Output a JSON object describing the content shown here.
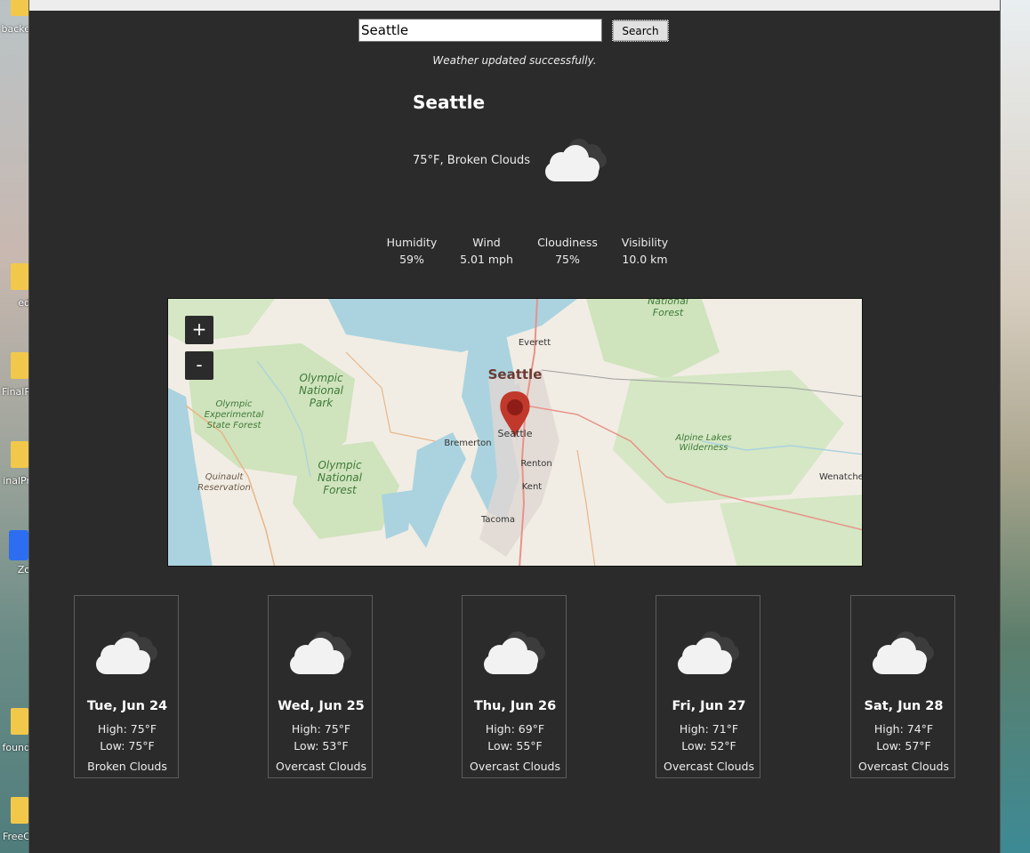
{
  "window": {
    "title_bar_visible": true
  },
  "desktop": {
    "icons": [
      {
        "label": "backe",
        "kind": "folder"
      },
      {
        "label": "ed",
        "kind": "folder"
      },
      {
        "label": "FinalP",
        "kind": "folder"
      },
      {
        "label": "inalPr",
        "kind": "folder"
      },
      {
        "label": "Zo",
        "kind": "zoom"
      },
      {
        "label": "found",
        "kind": "folder"
      },
      {
        "label": "FreeC",
        "kind": "folder"
      }
    ]
  },
  "search": {
    "value": "Seattle",
    "button_label": "Search"
  },
  "status_message": "Weather updated successfully.",
  "city": "Seattle",
  "current": {
    "summary": "75°F, Broken Clouds",
    "icon": "broken-clouds-icon"
  },
  "metrics": [
    {
      "label": "Humidity",
      "value": "59%"
    },
    {
      "label": "Wind",
      "value": "5.01 mph"
    },
    {
      "label": "Cloudiness",
      "value": "75%"
    },
    {
      "label": "Visibility",
      "value": "10.0 km"
    }
  ],
  "map": {
    "zoom_in": "+",
    "zoom_out": "-",
    "marker_label": "Seattle",
    "labels": {
      "national_forest_top": "National",
      "forest_top": "Forest",
      "everett": "Everett",
      "seattle_big": "Seattle",
      "olympic": "Olympic",
      "national": "National",
      "park": "Park",
      "olympic_exp": "Olympic",
      "experimental": "Experimental",
      "state_forest": "State Forest",
      "bremerton": "Bremerton",
      "renton": "Renton",
      "kent": "Kent",
      "tacoma": "Tacoma",
      "quinault": "Quinault",
      "reservation": "Reservation",
      "olympic_nf": "Olympic",
      "national_nf": "National",
      "forest_nf": "Forest",
      "alpine": "Alpine Lakes",
      "wilderness": "Wilderness",
      "wenatchee": "Wenatchee"
    }
  },
  "forecast": [
    {
      "date": "Tue, Jun 24",
      "high": "High: 75°F",
      "low": "Low: 75°F",
      "description": "Broken Clouds"
    },
    {
      "date": "Wed, Jun 25",
      "high": "High: 75°F",
      "low": "Low: 53°F",
      "description": "Overcast Clouds"
    },
    {
      "date": "Thu, Jun 26",
      "high": "High: 69°F",
      "low": "Low: 55°F",
      "description": "Overcast Clouds"
    },
    {
      "date": "Fri, Jun 27",
      "high": "High: 71°F",
      "low": "Low: 52°F",
      "description": "Overcast Clouds"
    },
    {
      "date": "Sat, Jun 28",
      "high": "High: 74°F",
      "low": "Low: 57°F",
      "description": "Overcast Clouds"
    }
  ],
  "colors": {
    "window_bg": "#2b2b2b",
    "marker": "#c0392b",
    "water": "#aad3df",
    "park": "#c8e0b0"
  }
}
